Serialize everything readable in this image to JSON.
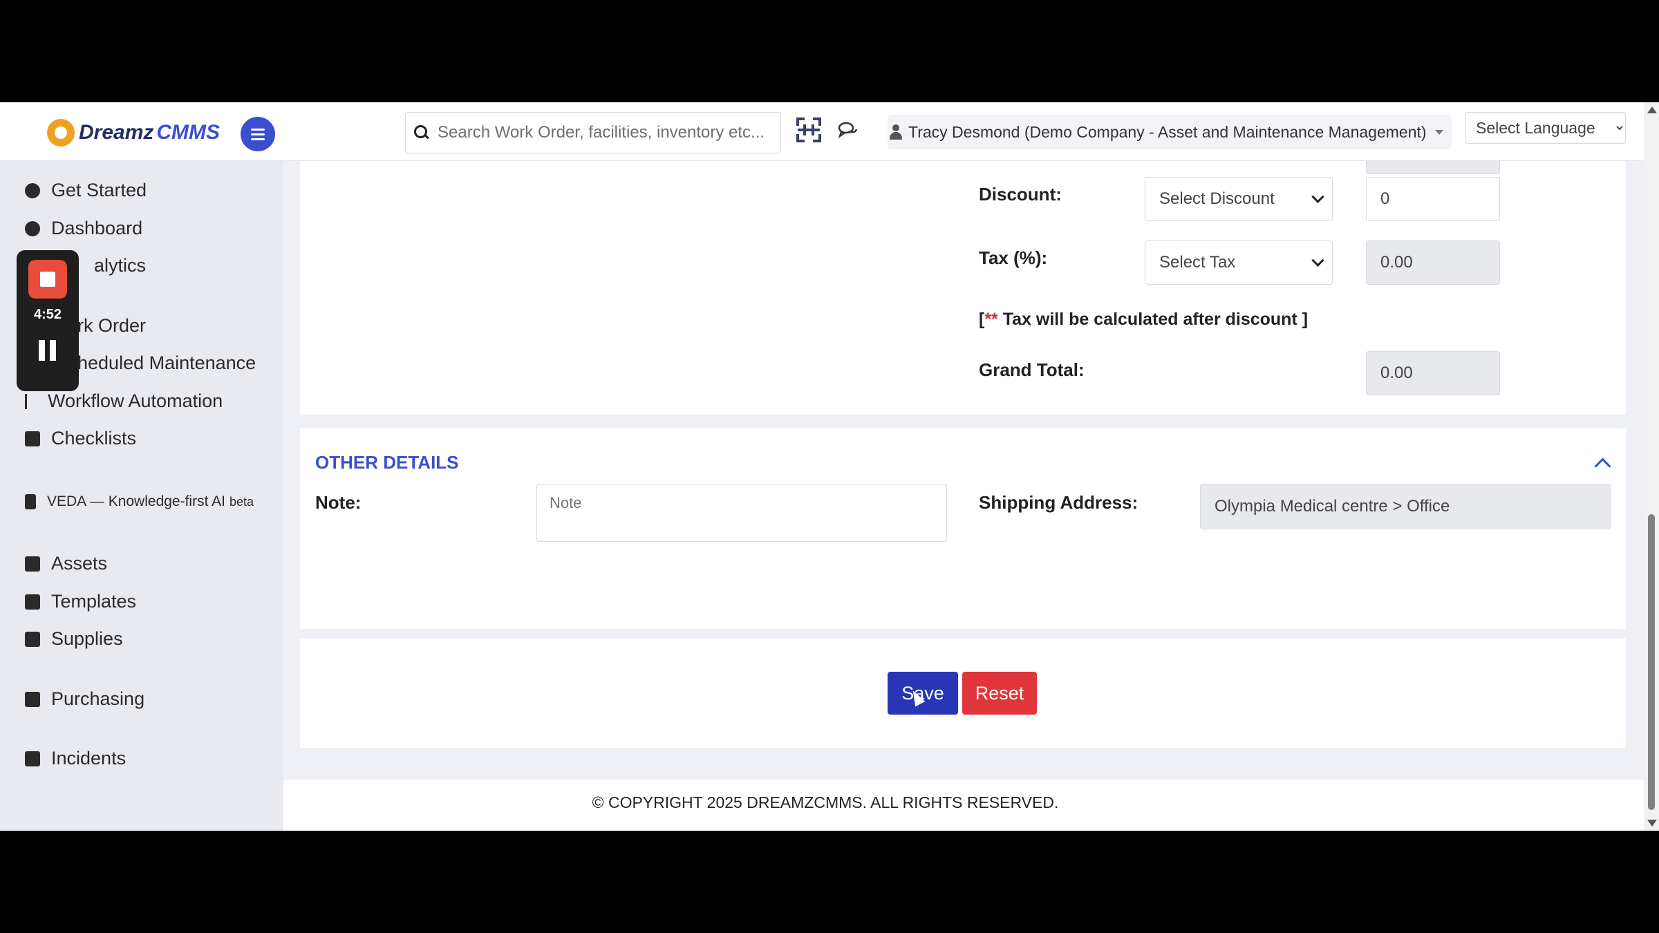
{
  "brand": {
    "name_a": "Dreamz",
    "name_b": "CMMS"
  },
  "search": {
    "placeholder": "Search Work Order, facilities, inventory etc..."
  },
  "user": {
    "label": "Tracy Desmond (Demo Company - Asset and Maintenance Management)"
  },
  "language": {
    "selected": "Select Language"
  },
  "sidebar": {
    "items": [
      {
        "label": "Get Started",
        "icon": "gears-icon"
      },
      {
        "label": "Dashboard",
        "icon": "dashboard-icon"
      },
      {
        "label": "alytics",
        "icon": "analytics-icon"
      },
      {
        "label": "rk Order",
        "icon": "work-order-icon"
      },
      {
        "label": "heduled Maintenance",
        "icon": "calendar-icon"
      },
      {
        "label": "Workflow Automation",
        "icon": "workflow-icon"
      },
      {
        "label": "Checklists",
        "icon": "checkbox-icon"
      },
      {
        "label": "VEDA — Knowledge-first AI",
        "badge": "beta",
        "icon": "document-icon"
      },
      {
        "label": "Assets",
        "icon": "archive-icon"
      },
      {
        "label": "Templates",
        "icon": "shuffle-icon"
      },
      {
        "label": "Supplies",
        "icon": "briefcase-icon"
      },
      {
        "label": "Purchasing",
        "icon": "cart-icon"
      },
      {
        "label": "Incidents",
        "icon": "cart-icon"
      }
    ]
  },
  "recorder": {
    "time": "4:52"
  },
  "totals": {
    "discount_label": "Discount:",
    "discount_select": "Select Discount",
    "discount_value": "0",
    "tax_label": "Tax (%):",
    "tax_select": "Select Tax",
    "tax_value": "0.00",
    "notice_open": "[",
    "notice_stars": "**",
    "notice_text": " Tax will be calculated after discount ]",
    "grand_total_label": "Grand Total:",
    "grand_total_value": "0.00"
  },
  "other_details": {
    "title": "OTHER DETAILS",
    "note_label": "Note:",
    "note_placeholder": "Note",
    "shipping_label": "Shipping Address:",
    "shipping_value": "Olympia Medical centre > Office"
  },
  "actions": {
    "save": "Save",
    "reset": "Reset"
  },
  "footer": {
    "copyright": "© COPYRIGHT 2025 DREAMZCMMS. ALL RIGHTS RESERVED."
  },
  "colors": {
    "accent": "#3a4fd0",
    "danger": "#e0353a",
    "save": "#2a36b8"
  }
}
